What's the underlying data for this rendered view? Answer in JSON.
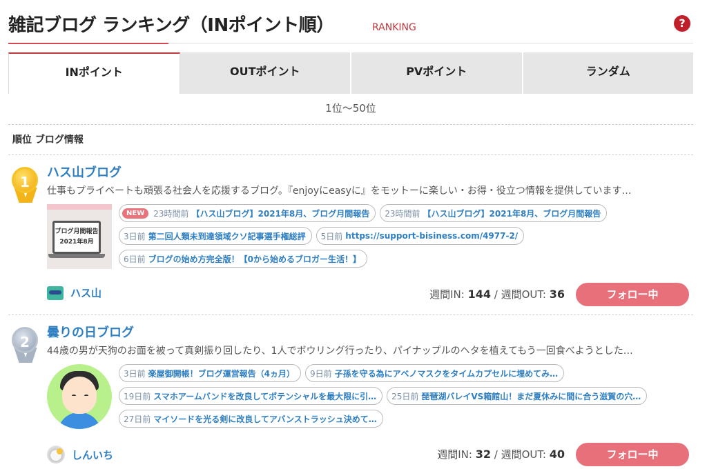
{
  "header": {
    "title": "雑記ブログ ランキング（INポイント順）",
    "subtitle": "RANKING",
    "help_icon": "?"
  },
  "tabs": [
    {
      "label": "INポイント",
      "active": true
    },
    {
      "label": "OUTポイント",
      "active": false
    },
    {
      "label": "PVポイント",
      "active": false
    },
    {
      "label": "ランダム",
      "active": false
    }
  ],
  "range_text": "1位〜50位",
  "column_header": "順位 ブログ情報",
  "entries": [
    {
      "rank": "1",
      "medal": "gold",
      "blog_name": "ハス山ブログ",
      "description": "仕事もプライベートも頑張る社会人を応援するブログ。『enjoyにeasyに』をモットーに楽しい・お得・役立つ情報を提供しています…",
      "thumb_text": [
        "ブログ月間報告",
        "2021年8月"
      ],
      "articles": [
        [
          {
            "new_badge": "NEW",
            "time": "23時間前",
            "title": "【ハス山ブログ】2021年8月、ブログ月間報告"
          },
          {
            "time": "23時間前",
            "title": "【ハス山ブログ】2021年8月、ブログ月間報告"
          }
        ],
        [
          {
            "time": "3日前",
            "title": "第二回人類未到達領域クソ記事選手権総評"
          },
          {
            "time": "5日前",
            "title": "https://support-bisiness.com/4977-2/"
          }
        ],
        [
          {
            "time": "6日前",
            "title": "ブログの始め方完全版！【0から始めるブロガー生活！】"
          }
        ]
      ],
      "author": "ハス山",
      "stats": {
        "in_label": "週間IN:",
        "in_value": "144",
        "sep": "/",
        "out_label": "週間OUT:",
        "out_value": "36"
      },
      "follow_label": "フォロー中"
    },
    {
      "rank": "2",
      "medal": "silver",
      "blog_name": "曇りの日ブログ",
      "description": "44歳の男が天狗のお面を被って真剣振り回したり、1人でボウリング行ったり、パイナップルのヘタを植えてもう一回食べようとした…",
      "articles": [
        [
          {
            "time": "3日前",
            "title": "楽屋御開帳！ブログ運営報告（4ヵ月）"
          },
          {
            "time": "9日前",
            "title": "子孫を守る為にアベノマスクをタイムカプセルに埋めてみ…"
          }
        ],
        [
          {
            "time": "19日前",
            "title": "スマホアームバンドを改良してポテンシャルを最大限に引…"
          },
          {
            "time": "25日前",
            "title": "琵琶湖バレイVS箱館山！まだ夏休みに間に合う滋賀の穴…"
          }
        ],
        [
          {
            "time": "27日前",
            "title": "マイソードを光る剣に改良してアバンストラッシュ決めて…"
          }
        ]
      ],
      "author": "しんいち",
      "stats": {
        "in_label": "週間IN:",
        "in_value": "32",
        "sep": "/",
        "out_label": "週間OUT:",
        "out_value": "40"
      },
      "follow_label": "フォロー中"
    }
  ],
  "colors": {
    "accent_red": "#c0383d",
    "link_blue": "#2e7ec2",
    "follow_pink": "#e8707a"
  }
}
